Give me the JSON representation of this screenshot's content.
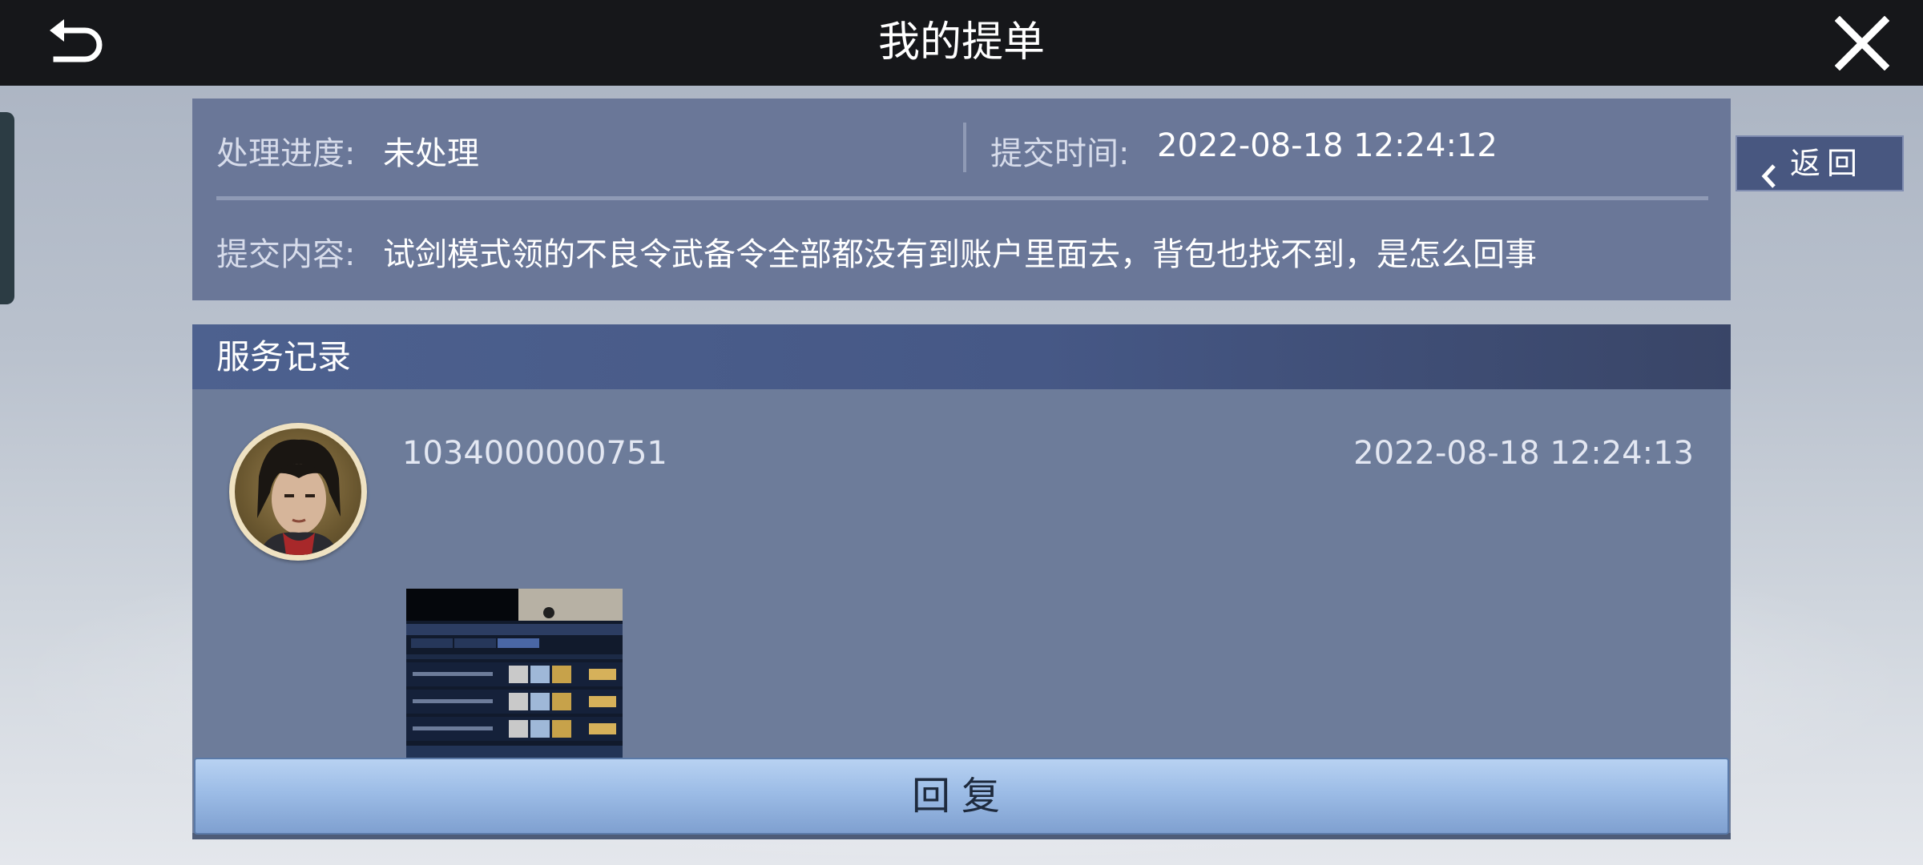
{
  "header": {
    "title": "我的提单"
  },
  "ticket": {
    "progress_label": "处理进度:",
    "progress_value": "未处理",
    "submit_time_label": "提交时间:",
    "submit_time_value": "2022-08-18 12:24:12",
    "content_label": "提交内容:",
    "content_value": "试剑模式领的不良令武备令全部都没有到账户里面去，背包也找不到，是怎么回事"
  },
  "return_button": {
    "label": "返回"
  },
  "service": {
    "title": "服务记录",
    "records": [
      {
        "user_id": "1034000000751",
        "time": "2022-08-18 12:24:13"
      }
    ]
  },
  "reply_button": {
    "label": "回复"
  },
  "colors": {
    "topbar": "#16171a",
    "panel": "#6a7798",
    "header_accent": "#4d618f",
    "reply_button": "#9cbce6"
  }
}
